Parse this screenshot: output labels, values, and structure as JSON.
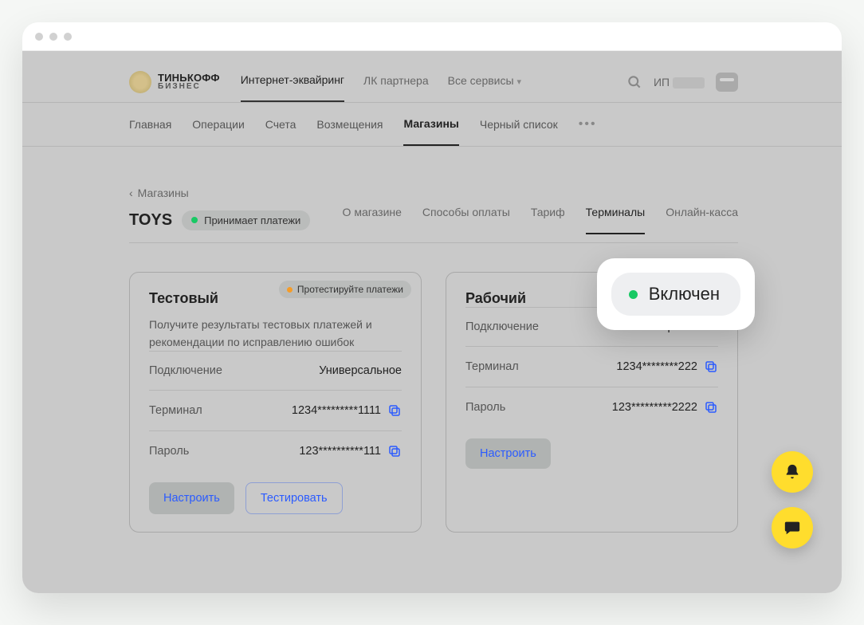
{
  "logo": {
    "brand": "ТИНЬКОФФ",
    "sub": "БИЗНЕС"
  },
  "topnav": {
    "acquiring": "Интернет-эквайринг",
    "partner": "ЛК партнера",
    "services": "Все сервисы"
  },
  "user_prefix": "ИП",
  "subnav": {
    "home": "Главная",
    "ops": "Операции",
    "accounts": "Счета",
    "refunds": "Возмещения",
    "shops": "Магазины",
    "blacklist": "Черный список"
  },
  "breadcrumb": "Магазины",
  "page_title": "TOYS",
  "page_status": "Принимает платежи",
  "tabs": {
    "about": "О магазине",
    "methods": "Способы оплаты",
    "tariff": "Тариф",
    "terminals": "Терминалы",
    "cashbox": "Онлайн-касса"
  },
  "card_test": {
    "title": "Тестовый",
    "badge": "Протестируйте платежи",
    "desc": "Получите результаты тестовых платежей и рекомендации по исправлению ошибок",
    "conn_label": "Подключение",
    "conn_value": "Универсальное",
    "term_label": "Терминал",
    "term_value": "1234*********1111",
    "pass_label": "Пароль",
    "pass_value": "123**********111",
    "btn_configure": "Настроить",
    "btn_test": "Тестировать"
  },
  "card_prod": {
    "title": "Рабочий",
    "badge": "Включен",
    "conn_label": "Подключение",
    "conn_value": "Универсальное",
    "term_label": "Терминал",
    "term_value": "1234********222",
    "pass_label": "Пароль",
    "pass_value": "123*********2222",
    "btn_configure": "Настроить"
  }
}
